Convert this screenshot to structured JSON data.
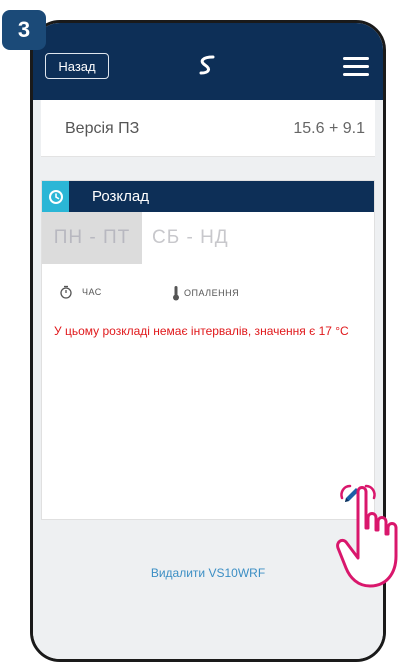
{
  "step": "3",
  "header": {
    "back_label": "Назад"
  },
  "version": {
    "label": "Версія ПЗ",
    "value": "15.6 + 9.1"
  },
  "schedule": {
    "title": "Розклад",
    "tabs": [
      {
        "label": "ПН - ПТ"
      },
      {
        "label": "СБ - НД"
      }
    ],
    "columns": {
      "time": "ЧАС",
      "heating": "ОПАЛЕННЯ"
    },
    "notice": "У цьому розкладі немає інтервалів, значення є 17 °C"
  },
  "delete_label": "Видалити VS10WRF",
  "colors": {
    "header_bg": "#0d2f57",
    "accent_cyan": "#2bb6d6",
    "notice_red": "#e0181b",
    "link_blue": "#3b8ec4",
    "hand_pink": "#d9176c"
  },
  "icons": {
    "schedule": "clock-refresh-icon",
    "time": "stopwatch-icon",
    "heating": "thermometer-icon",
    "edit": "pencil-icon",
    "menu": "hamburger-icon",
    "logo": "brand-logo-icon",
    "hand": "pointing-hand-icon"
  }
}
